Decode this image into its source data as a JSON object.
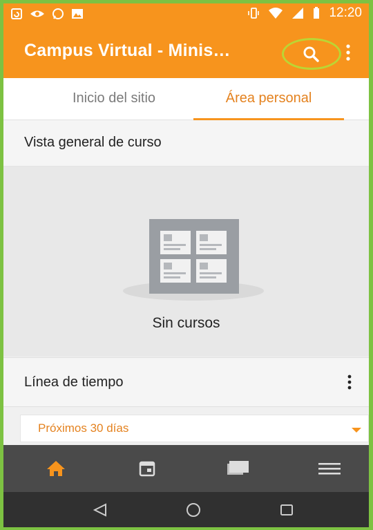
{
  "status_bar": {
    "time": "12:20",
    "left_icons": [
      "sync-icon",
      "eye-icon",
      "whatsapp-icon",
      "image-icon"
    ],
    "right_icons": [
      "vibrate-icon",
      "wifi-icon",
      "signal-icon",
      "battery-icon"
    ]
  },
  "app_bar": {
    "title": "Campus Virtual - Minis…",
    "search_icon": "search-icon",
    "menu_icon": "more-vert-icon",
    "highlight_color": "#bcd534"
  },
  "tabs": [
    {
      "label": "Inicio del sitio",
      "active": false
    },
    {
      "label": "Área personal",
      "active": true
    }
  ],
  "course_overview": {
    "heading": "Vista general de curso",
    "empty_text": "Sin cursos"
  },
  "timeline": {
    "heading": "Línea de tiempo",
    "filter_selected": "Próximos 30 días"
  },
  "bottom_nav": [
    "home-icon",
    "calendar-icon",
    "messages-icon",
    "menu-icon"
  ],
  "system_nav": [
    "back-icon",
    "home-circle-icon",
    "recents-icon"
  ],
  "colors": {
    "accent": "#f7941d",
    "frame": "#7dc242",
    "bottom_nav_bg": "#4a4a4a",
    "system_nav_bg": "#303030"
  }
}
